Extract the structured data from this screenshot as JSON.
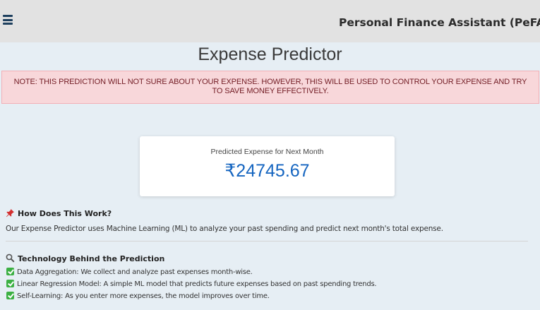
{
  "header": {
    "brand": "Personal Finance Assistant (PeFA)",
    "menu_icon": "hamburger-menu-icon"
  },
  "page": {
    "title": "Expense Predictor"
  },
  "alert": {
    "text": "NOTE: THIS PREDICTION WILL NOT SURE ABOUT YOUR EXPENSE. HOWEVER, THIS WILL BE USED TO CONTROL YOUR EXPENSE AND TRY TO SAVE MONEY EFFECTIVELY."
  },
  "prediction": {
    "label": "Predicted Expense for Next Month",
    "value": "₹24745.67"
  },
  "how": {
    "icon": "pushpin-icon",
    "heading": "How Does This Work?",
    "text": "Our Expense Predictor uses Machine Learning (ML) to analyze your past spending and predict next month's total expense."
  },
  "tech": {
    "icon": "magnifier-icon",
    "heading": "Technology Behind the Prediction",
    "items": [
      "Data Aggregation: We collect and analyze past expenses month-wise.",
      "Linear Regression Model: A simple ML model that predicts future expenses based on past spending trends.",
      "Self-Learning: As you enter more expenses, the model improves over time."
    ]
  },
  "colors": {
    "accent": "#1565c0",
    "alert_bg": "#f8d7da",
    "alert_text": "#721c24",
    "check": "#3cb043"
  }
}
